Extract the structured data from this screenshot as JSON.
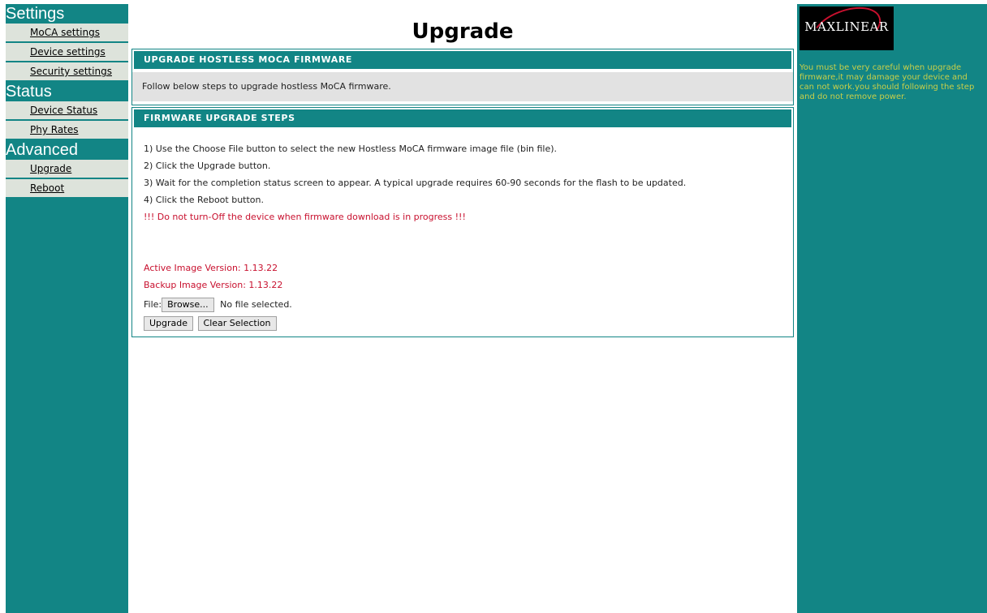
{
  "sidebar": {
    "sections": [
      {
        "title": "Settings",
        "items": [
          "MoCA settings",
          "Device settings",
          "Security settings"
        ]
      },
      {
        "title": "Status",
        "items": [
          "Device Status",
          "Phy Rates"
        ]
      },
      {
        "title": "Advanced",
        "items": [
          "Upgrade",
          "Reboot"
        ]
      }
    ]
  },
  "page": {
    "title": "Upgrade"
  },
  "panel1": {
    "header": "UPGRADE HOSTLESS MOCA FIRMWARE",
    "text": "Follow below steps to upgrade hostless MoCA firmware."
  },
  "panel2": {
    "header": "FIRMWARE UPGRADE STEPS",
    "steps": [
      "1) Use the Choose File button to select the new Hostless MoCA firmware image file (bin file).",
      "2) Click the Upgrade button.",
      "3) Wait for the completion status screen to appear. A typical upgrade requires 60-90 seconds for the flash to be updated.",
      "4) Click the Reboot button."
    ],
    "warning": "!!! Do not turn-Off the device when firmware download is in progress !!!",
    "active_version": "Active Image Version: 1.13.22",
    "backup_version": "Backup Image Version: 1.13.22",
    "file_label": "File:",
    "browse_label": "Browse...",
    "file_status": "No file selected.",
    "upgrade_label": "Upgrade",
    "clear_label": "Clear Selection"
  },
  "right": {
    "logo_text": "MAXLINEAR",
    "note": "You must be very careful when upgrade firmware,it may damage your device and can not work.you should following the step and do not remove power."
  },
  "colors": {
    "teal": "#128585",
    "warning": "#c8102e",
    "note": "#c8cf4a"
  }
}
